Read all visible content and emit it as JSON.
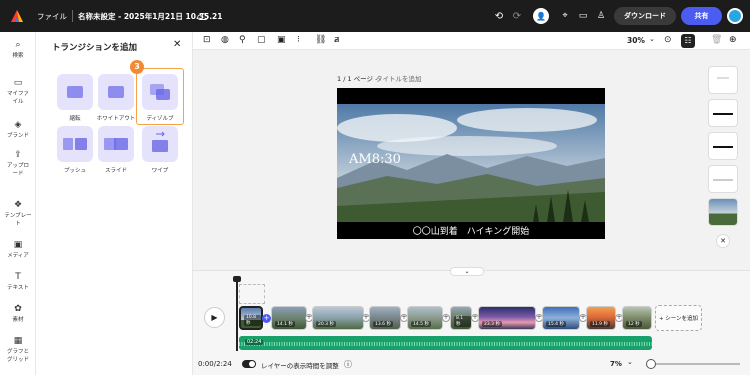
{
  "topbar": {
    "file": "ファイル",
    "title": "名称未設定 - 2025年1月21日 10.35.21",
    "download": "ダウンロード",
    "share": "共有"
  },
  "toolbar": {
    "zoom": "30%"
  },
  "nav": [
    {
      "label": "検索",
      "icon": "search-icon"
    },
    {
      "label": "マイファイル",
      "icon": "folder-icon"
    },
    {
      "label": "ブランド",
      "icon": "brand-icon"
    },
    {
      "label": "アップロード",
      "icon": "upload-icon"
    },
    {
      "label": "テンプレート",
      "icon": "template-icon"
    },
    {
      "label": "メディア",
      "icon": "media-icon"
    },
    {
      "label": "テキスト",
      "icon": "text-icon"
    },
    {
      "label": "素材",
      "icon": "elements-icon"
    },
    {
      "label": "グラフとグリッド",
      "icon": "grid-icon"
    }
  ],
  "panel": {
    "title": "トランジションを追加",
    "badge": "3",
    "items": [
      "縮転",
      "ホワイトアウト",
      "ディゾルブ",
      "プッシュ",
      "スライド",
      "ワイプ"
    ]
  },
  "canvas": {
    "page_label": "1 / 1 ページ -",
    "page_title_placeholder": "タイトルを追加",
    "time_text": "AM8:30",
    "caption": "〇〇山到着　ハイキング開始"
  },
  "timeline": {
    "clips": [
      "10.8 秒",
      "14.1 秒",
      "20.3 秒",
      "13.6 秒",
      "14.5 秒",
      "8.1 秒",
      "23.3 秒",
      "15.4 秒",
      "11.9 秒",
      "12 秒"
    ],
    "add_scene": "+ シーンを追加",
    "audio_time": "02:24",
    "time": "0:00/2:24",
    "toggle_label": "レイヤーの表示時間を調整",
    "zoom": "7%"
  }
}
